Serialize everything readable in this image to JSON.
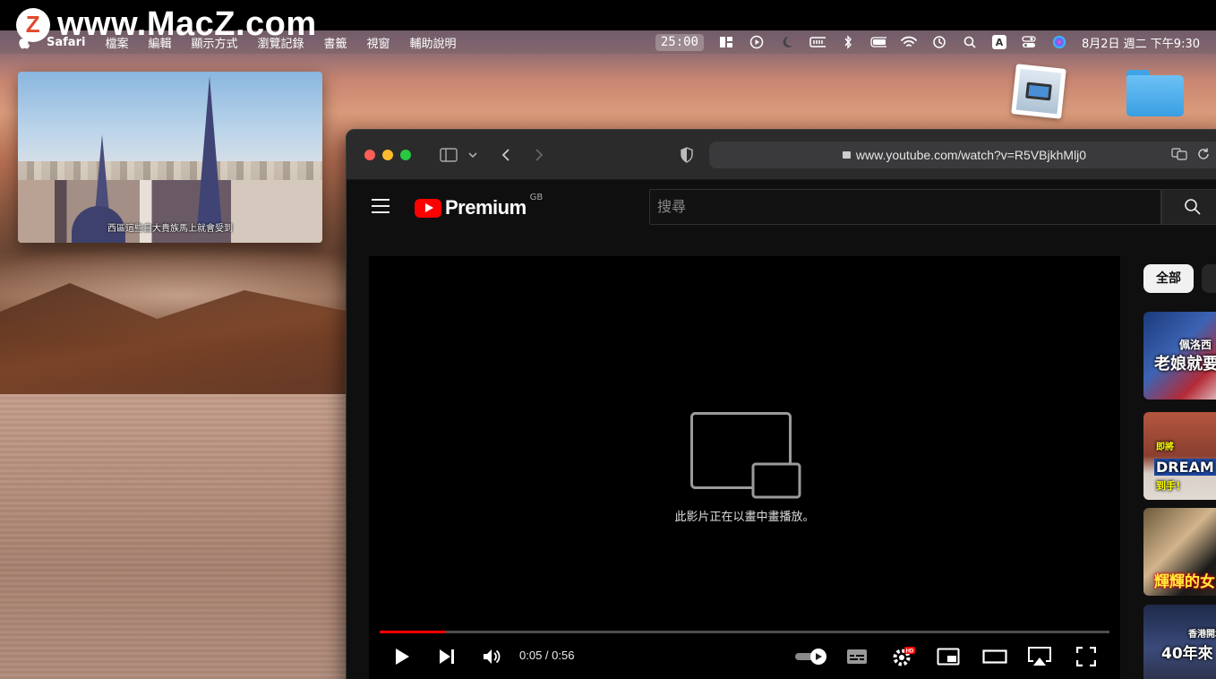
{
  "watermark": {
    "text": "www.MacZ.com",
    "logo": "Z"
  },
  "menubar": {
    "apple_icon": "apple-icon",
    "app_name": "Safari",
    "items": [
      "檔案",
      "編輯",
      "顯示方式",
      "瀏覽記錄",
      "書籤",
      "視窗",
      "輔助說明"
    ],
    "timer": "25:00",
    "input_source": "A",
    "clock": "8月2日 週二 下午9:30"
  },
  "pip_window": {
    "subtitle": "西區這些自大貴族馬上就會受到"
  },
  "safari": {
    "url": "www.youtube.com/watch?v=R5VBjkhMlj0"
  },
  "youtube": {
    "brand": "Premium",
    "country": "GB",
    "search_placeholder": "搜尋",
    "player": {
      "pip_message": "此影片正在以畫中畫播放。",
      "time": "0:05 / 0:56",
      "progress": 0.09
    },
    "sidebar": {
      "chip_all": "全部",
      "thumbnails": [
        {
          "title": "老娘就要",
          "top_text": "佩洛西"
        },
        {
          "title": "DREAM CA",
          "top_text": "即將",
          "bottom_text": "到手！"
        },
        {
          "title": "輝輝的女"
        },
        {
          "title": "40年來",
          "top_text": "香港開埠"
        }
      ]
    }
  }
}
